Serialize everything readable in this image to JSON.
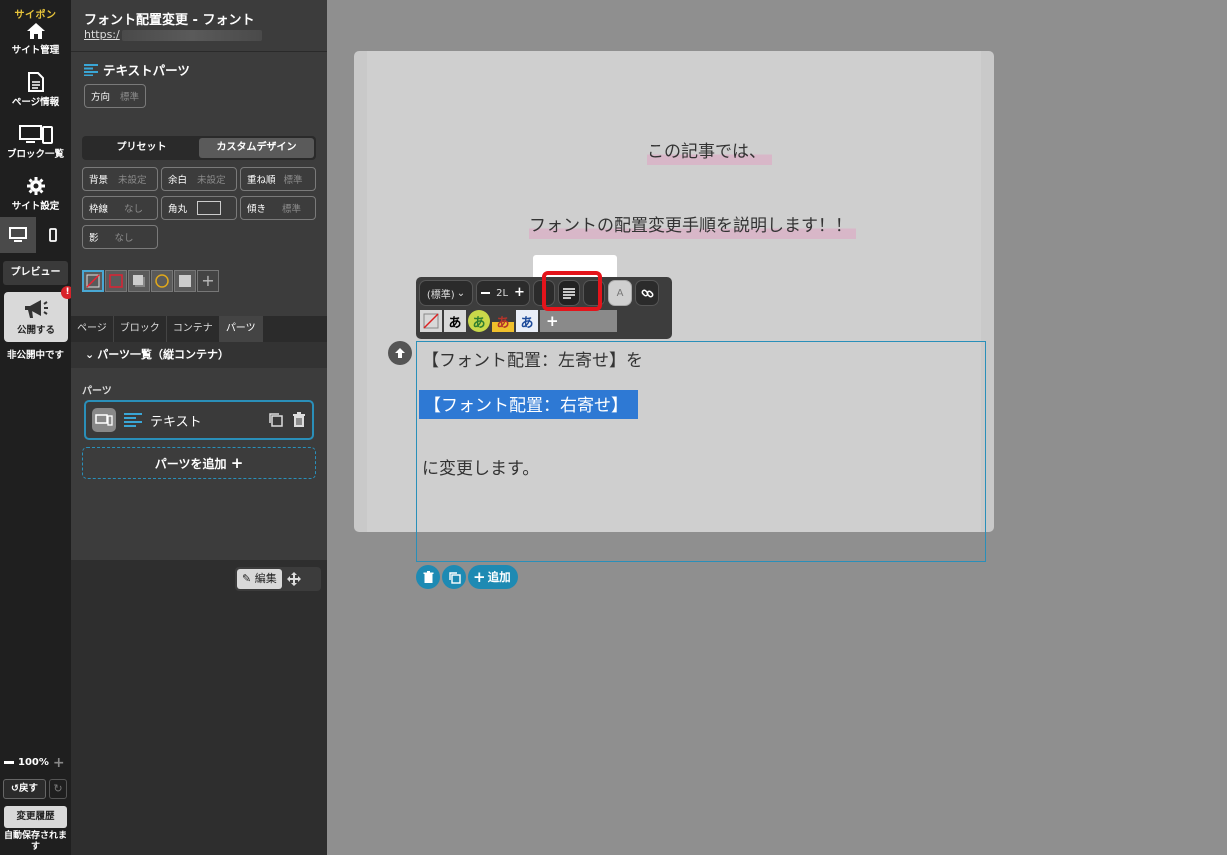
{
  "rail": {
    "brand": "サイポン",
    "site_manage": "サイト管理",
    "page_info": "ページ情報",
    "block_list": "ブロック一覧",
    "site_settings": "サイト設定",
    "preview": "プレビュー",
    "publish": "公開する",
    "publish_badge": "!",
    "unpublished": "非公開中です",
    "zoom": "100%",
    "undo": "戻す",
    "history": "変更履歴",
    "autosave": "自動保存されます"
  },
  "panel": {
    "page_title": "フォント配置変更 - フォント",
    "page_url": "https:/",
    "part_title": "テキストパーツ",
    "direction": {
      "label": "方向",
      "value": "標準"
    },
    "design_tabs": [
      "プリセット",
      "カスタムデザイン"
    ],
    "props": [
      {
        "label": "背景",
        "value": "未設定"
      },
      {
        "label": "余白",
        "value": "未設定"
      },
      {
        "label": "重ね順",
        "value": "標準"
      },
      {
        "label": "枠線",
        "value": "なし"
      },
      {
        "label": "角丸",
        "value": ""
      },
      {
        "label": "傾き",
        "value": "標準"
      },
      {
        "label": "影",
        "value": "なし"
      }
    ],
    "nav_tabs": [
      "ページ",
      "ブロック",
      "コンテナ",
      "パーツ"
    ],
    "list_header": "パーツ一覧（縦コンテナ）",
    "section_label": "パーツ",
    "part_item": "テキスト",
    "add_part": "パーツを追加",
    "edit": "編集"
  },
  "editor": {
    "para1": "この記事では、",
    "para2": "フォントの配置変更手順を説明します！！",
    "toolbar": {
      "font_select": "(標準)",
      "size": "2L",
      "color_label": "A",
      "chars": [
        "あ",
        "あ",
        "あ",
        "あ"
      ]
    },
    "text_lines": [
      "【フォント配置：左寄せ】を",
      "【フォント配置：右寄せ】",
      "に変更します。"
    ],
    "add": "追加"
  },
  "colors": {
    "accent": "#1e8ab3",
    "highlight_red": "#e4141b",
    "selection": "#2e79d4"
  }
}
